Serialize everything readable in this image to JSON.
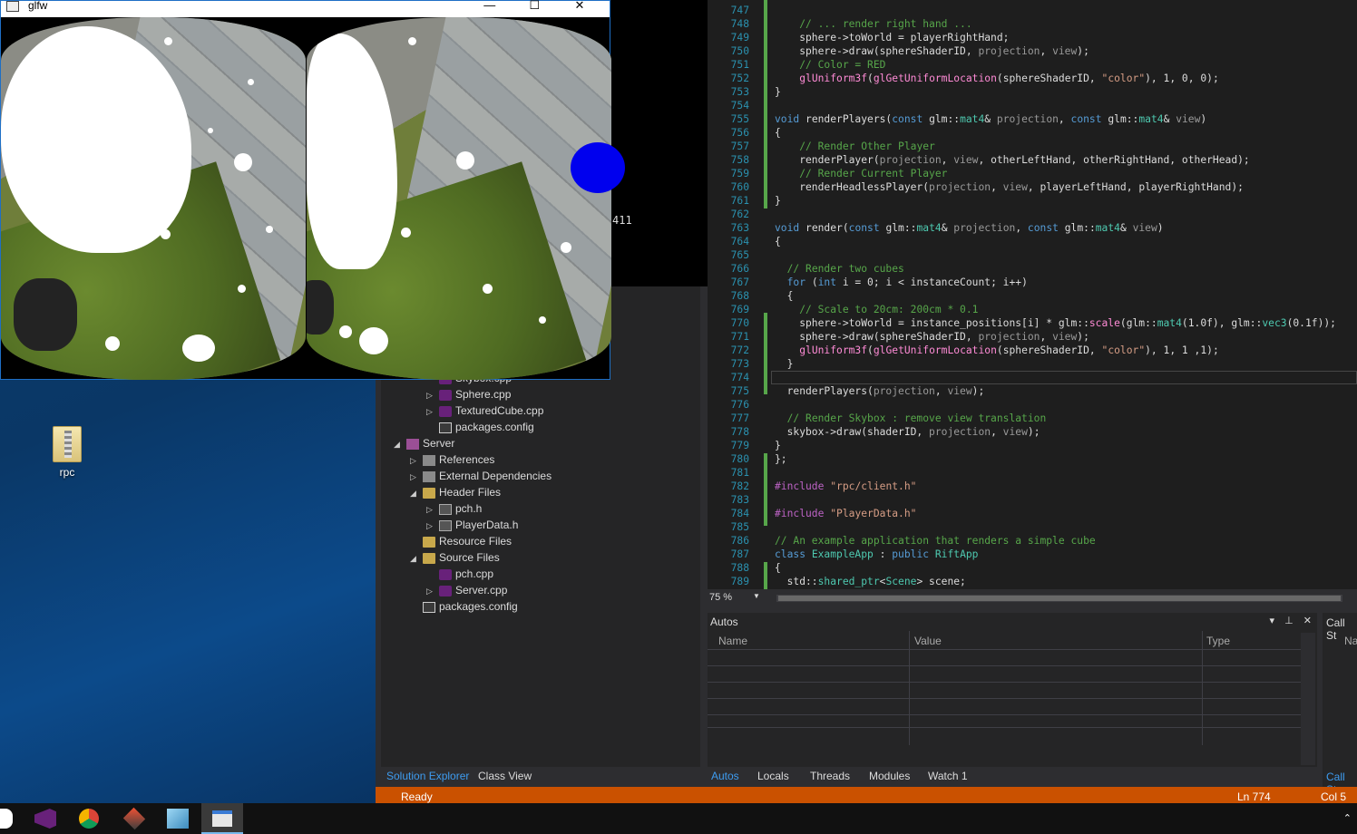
{
  "glfw": {
    "title": "glfw",
    "minimize": "—",
    "maximize": "☐",
    "close": "✕"
  },
  "console": {
    "text": "411"
  },
  "desktop": {
    "icon_label": "rpc"
  },
  "editor": {
    "zoom": "75 %",
    "lines": [
      {
        "n": "747",
        "html": ""
      },
      {
        "n": "748",
        "html": "    <span class='cm'>// ... render right hand ...</span>"
      },
      {
        "n": "749",
        "html": "    sphere-&gt;toWorld = playerRightHand;"
      },
      {
        "n": "750",
        "html": "    sphere-&gt;draw(sphereShaderID, <span class='pm'>projection</span>, <span class='pm'>view</span>);"
      },
      {
        "n": "751",
        "html": "    <span class='cm'>// Color = RED</span>"
      },
      {
        "n": "752",
        "html": "    <span class='fn'>glUniform3f</span>(<span class='fn'>glGetUniformLocation</span>(sphereShaderID, <span class='str'>\"color\"</span>), 1, 0, 0);"
      },
      {
        "n": "753",
        "html": "}"
      },
      {
        "n": "754",
        "html": ""
      },
      {
        "n": "755",
        "html": "<span class='kw'>void</span> renderPlayers(<span class='kw'>const</span> glm::<span class='ty'>mat4</span>&amp; <span class='pm'>projection</span>, <span class='kw'>const</span> glm::<span class='ty'>mat4</span>&amp; <span class='pm'>view</span>)"
      },
      {
        "n": "756",
        "html": "{"
      },
      {
        "n": "757",
        "html": "    <span class='cm'>// Render Other Player</span>"
      },
      {
        "n": "758",
        "html": "    renderPlayer(<span class='pm'>projection</span>, <span class='pm'>view</span>, otherLeftHand, otherRightHand, otherHead);"
      },
      {
        "n": "759",
        "html": "    <span class='cm'>// Render Current Player</span>"
      },
      {
        "n": "760",
        "html": "    renderHeadlessPlayer(<span class='pm'>projection</span>, <span class='pm'>view</span>, playerLeftHand, playerRightHand);"
      },
      {
        "n": "761",
        "html": "}"
      },
      {
        "n": "762",
        "html": ""
      },
      {
        "n": "763",
        "html": "<span class='kw'>void</span> render(<span class='kw'>const</span> glm::<span class='ty'>mat4</span>&amp; <span class='pm'>projection</span>, <span class='kw'>const</span> glm::<span class='ty'>mat4</span>&amp; <span class='pm'>view</span>)"
      },
      {
        "n": "764",
        "html": "{"
      },
      {
        "n": "765",
        "html": ""
      },
      {
        "n": "766",
        "html": "  <span class='cm'>// Render two cubes</span>"
      },
      {
        "n": "767",
        "html": "  <span class='kw'>for</span> (<span class='kw'>int</span> i = 0; i &lt; instanceCount; i++)"
      },
      {
        "n": "768",
        "html": "  {"
      },
      {
        "n": "769",
        "html": "    <span class='cm'>// Scale to 20cm: 200cm * 0.1</span>"
      },
      {
        "n": "770",
        "html": "    sphere-&gt;toWorld = instance_positions[i] * glm::<span class='fn'>scale</span>(glm::<span class='ty'>mat4</span>(1.0f), glm::<span class='ty'>vec3</span>(0.1f));"
      },
      {
        "n": "771",
        "html": "    sphere-&gt;draw(sphereShaderID, <span class='pm'>projection</span>, <span class='pm'>view</span>);"
      },
      {
        "n": "772",
        "html": "    <span class='fn'>glUniform3f</span>(<span class='fn'>glGetUniformLocation</span>(sphereShaderID, <span class='str'>\"color\"</span>), 1, 1 ,1);"
      },
      {
        "n": "773",
        "html": "  }"
      },
      {
        "n": "774",
        "html": ""
      },
      {
        "n": "775",
        "html": "  renderPlayers(<span class='pm'>projection</span>, <span class='pm'>view</span>);"
      },
      {
        "n": "776",
        "html": ""
      },
      {
        "n": "777",
        "html": "  <span class='cm'>// Render Skybox : remove view translation</span>"
      },
      {
        "n": "778",
        "html": "  skybox-&gt;draw(shaderID, <span class='pm'>projection</span>, <span class='pm'>view</span>);"
      },
      {
        "n": "779",
        "html": "}"
      },
      {
        "n": "780",
        "html": "};"
      },
      {
        "n": "781",
        "html": ""
      },
      {
        "n": "782",
        "html": "<span class='mac'>#include</span> <span class='str'>\"rpc/client.h\"</span>"
      },
      {
        "n": "783",
        "html": ""
      },
      {
        "n": "784",
        "html": "<span class='mac'>#include</span> <span class='str'>\"PlayerData.h\"</span>"
      },
      {
        "n": "785",
        "html": ""
      },
      {
        "n": "786",
        "html": "<span class='cm'>// An example application that renders a simple cube</span>"
      },
      {
        "n": "787",
        "html": "<span class='kw'>class</span> <span class='ty'>ExampleApp</span> : <span class='kw'>public</span> <span class='ty'>RiftApp</span>"
      },
      {
        "n": "788",
        "html": "{"
      },
      {
        "n": "789",
        "html": "  std::<span class='ty'>shared_ptr</span>&lt;<span class='ty'>Scene</span>&gt; scene;"
      }
    ]
  },
  "solution": {
    "items": [
      {
        "label": "Skybox.cpp",
        "arrow": "",
        "icon": "cpp",
        "indent": 3
      },
      {
        "label": "Sphere.cpp",
        "arrow": "▷",
        "icon": "cpp",
        "indent": 3
      },
      {
        "label": "TexturedCube.cpp",
        "arrow": "▷",
        "icon": "cpp",
        "indent": 3
      },
      {
        "label": "packages.config",
        "arrow": "",
        "icon": "config",
        "indent": 3
      },
      {
        "label": "Server",
        "arrow": "◢",
        "icon": "proj",
        "indent": 1
      },
      {
        "label": "References",
        "arrow": "▷",
        "icon": "ref",
        "indent": 2
      },
      {
        "label": "External Dependencies",
        "arrow": "▷",
        "icon": "ref",
        "indent": 2
      },
      {
        "label": "Header Files",
        "arrow": "◢",
        "icon": "folder",
        "indent": 2
      },
      {
        "label": "pch.h",
        "arrow": "▷",
        "icon": "h",
        "indent": 3
      },
      {
        "label": "PlayerData.h",
        "arrow": "▷",
        "icon": "h",
        "indent": 3
      },
      {
        "label": "Resource Files",
        "arrow": "",
        "icon": "folder",
        "indent": 2
      },
      {
        "label": "Source Files",
        "arrow": "◢",
        "icon": "folder",
        "indent": 2
      },
      {
        "label": "pch.cpp",
        "arrow": "",
        "icon": "cpp",
        "indent": 3
      },
      {
        "label": "Server.cpp",
        "arrow": "▷",
        "icon": "cpp",
        "indent": 3
      },
      {
        "label": "packages.config",
        "arrow": "",
        "icon": "config",
        "indent": 2
      }
    ],
    "tab_solution": "Solution Explorer",
    "tab_class": "Class View"
  },
  "autos": {
    "title": "Autos",
    "col_name": "Name",
    "col_value": "Value",
    "col_type": "Type",
    "tabs": [
      "Autos",
      "Locals",
      "Threads",
      "Modules",
      "Watch 1"
    ]
  },
  "callstack": {
    "title": "Call St",
    "col": "Na",
    "tab": "Call St"
  },
  "status": {
    "ready": "Ready",
    "ln": "Ln 774",
    "col": "Col 5"
  }
}
